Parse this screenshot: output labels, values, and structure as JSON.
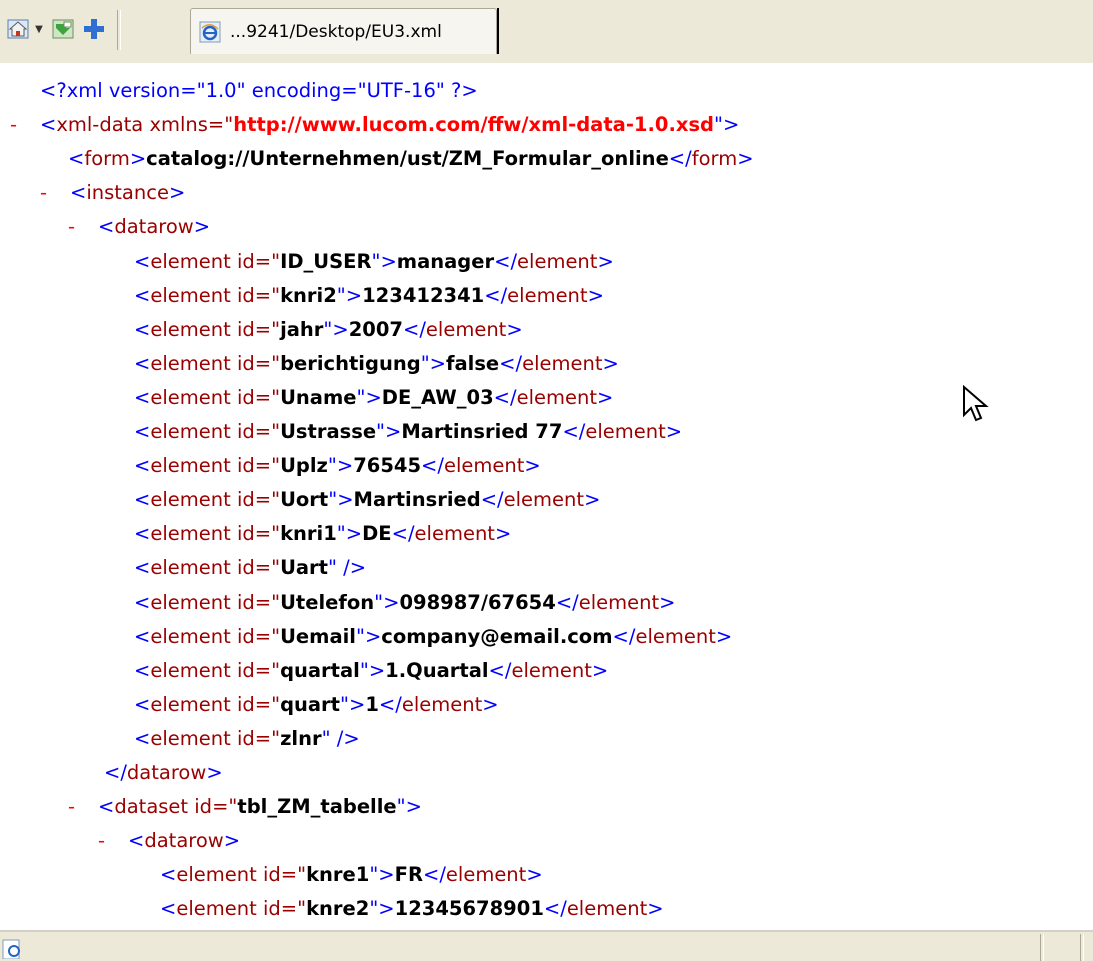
{
  "toolbar": {
    "tab_title": "...9241/Desktop/EU3.xml",
    "buttons": [
      "home-icon",
      "chevron-down-icon",
      "feed-icon",
      "add-tab-icon"
    ]
  },
  "xml": {
    "pi": "<?xml version=\"1.0\" encoding=\"UTF-16\" ?>",
    "root_open": "<xml-data xmlns=\"",
    "root_ns": "http://www.lucom.com/ffw/xml-data-1.0.xsd",
    "root_close": "\">",
    "form_open": "<form>",
    "form_value": "catalog://Unternehmen/ust/ZM_Formular_online",
    "form_close": "</form>",
    "instance_open": "<instance>",
    "datarow_open": "<datarow>",
    "datarow_close": "</datarow>",
    "element_prefix": "<element id=\"",
    "attr_end": "\">",
    "element_close": "</element>",
    "selfclose_end": "\" />",
    "elements": [
      {
        "id": "ID_USER",
        "value": "manager"
      },
      {
        "id": "knri2",
        "value": "123412341"
      },
      {
        "id": "jahr",
        "value": "2007"
      },
      {
        "id": "berichtigung",
        "value": "false"
      },
      {
        "id": "Uname",
        "value": "DE_AW_03"
      },
      {
        "id": "Ustrasse",
        "value": "Martinsried 77"
      },
      {
        "id": "Uplz",
        "value": "76545"
      },
      {
        "id": "Uort",
        "value": "Martinsried"
      },
      {
        "id": "knri1",
        "value": "DE"
      },
      {
        "id": "Uart",
        "value": null
      },
      {
        "id": "Utelefon",
        "value": "098987/67654"
      },
      {
        "id": "Uemail",
        "value": "company@email.com"
      },
      {
        "id": "quartal",
        "value": "1.Quartal"
      },
      {
        "id": "quart",
        "value": "1"
      },
      {
        "id": "zlnr",
        "value": null
      }
    ],
    "dataset_open": "<dataset id=\"",
    "dataset_id": "tbl_ZM_tabelle",
    "dataset_end": "\">",
    "dataset_elements": [
      {
        "id": "knre1",
        "value": "FR"
      },
      {
        "id": "knre2",
        "value": "12345678901"
      }
    ],
    "collapse_symbol": "-"
  },
  "colors": {
    "markup": "#0000ff",
    "tag_name": "#990000",
    "value": "#000000",
    "namespace": "#ff0000",
    "collapse": "#ff0000"
  }
}
